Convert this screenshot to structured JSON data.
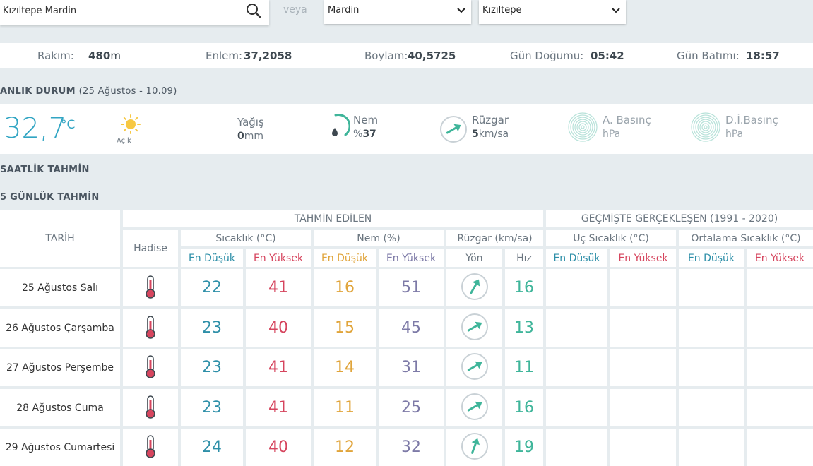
{
  "search": {
    "value": "Kızıltepe Mardin"
  },
  "veya": "veya",
  "selects": {
    "province": "Mardin",
    "district": "Kızıltepe"
  },
  "info": {
    "altitude_label": "Rakım:",
    "altitude_value": "480",
    "altitude_unit": "m",
    "lat_label": "Enlem:",
    "lat_value": "37,2058",
    "lon_label": "Boylam:",
    "lon_value": "40,5725",
    "sunrise_label": "Gün Doğumu:",
    "sunrise_value": "05:42",
    "sunset_label": "Gün Batımı:",
    "sunset_value": "18:57"
  },
  "current": {
    "title": "ANLIK DURUM",
    "subtitle": "(25 Ağustos - 10.09)",
    "temperature": "32,7",
    "temperature_unit": "°C",
    "sky": "Açık",
    "sky_icon": "sun-icon",
    "precip_label": "Yağış",
    "precip_value": "0",
    "precip_unit": "mm",
    "humidity_label": "Nem",
    "humidity_prefix": "%",
    "humidity_value": "37",
    "wind_label": "Rüzgar",
    "wind_value": "5",
    "wind_unit": "km/sa",
    "pressure_label": "A. Basınç",
    "pressure_unit": "hPa",
    "sea_pressure_label": "D.İ.Basınç",
    "sea_pressure_unit": "hPa"
  },
  "hourly_title": "SAATLİK TAHMİN",
  "daily_title": "5 GÜNLÜK TAHMİN",
  "table": {
    "group_forecast": "TAHMİN EDİLEN",
    "group_history": "GEÇMİŞTE GERÇEKLEŞEN (1991 - 2020)",
    "date_header": "TARİH",
    "hadise_header": "Hadise",
    "temp_header": "Sıcaklık (°C)",
    "hum_header": "Nem (%)",
    "wind_header": "Rüzgar (km/sa)",
    "extreme_header": "Uç Sıcaklık (°C)",
    "avg_header": "Ortalama Sıcaklık (°C)",
    "min_label": "En Düşük",
    "max_label": "En Yüksek",
    "dir_label": "Yön",
    "speed_label": "Hız",
    "rows": [
      {
        "date": "25 Ağustos Salı",
        "tmin": "22",
        "tmax": "41",
        "hmin": "16",
        "hmax": "51",
        "wind_dir_deg": 30,
        "speed": "16"
      },
      {
        "date": "26 Ağustos Çarşamba",
        "tmin": "23",
        "tmax": "40",
        "hmin": "15",
        "hmax": "45",
        "wind_dir_deg": 60,
        "speed": "13"
      },
      {
        "date": "27 Ağustos Perşembe",
        "tmin": "23",
        "tmax": "41",
        "hmin": "14",
        "hmax": "31",
        "wind_dir_deg": 60,
        "speed": "11"
      },
      {
        "date": "28 Ağustos Cuma",
        "tmin": "23",
        "tmax": "41",
        "hmin": "11",
        "hmax": "25",
        "wind_dir_deg": 60,
        "speed": "16"
      },
      {
        "date": "29 Ağustos Cumartesi",
        "tmin": "24",
        "tmax": "40",
        "hmin": "12",
        "hmax": "32",
        "wind_dir_deg": 20,
        "speed": "19"
      }
    ]
  },
  "colors": {
    "temp_accent": "#31a5c3",
    "wind_accent": "#3fb59a",
    "max_red": "#d6455e",
    "min_blue": "#2e8fa8"
  }
}
